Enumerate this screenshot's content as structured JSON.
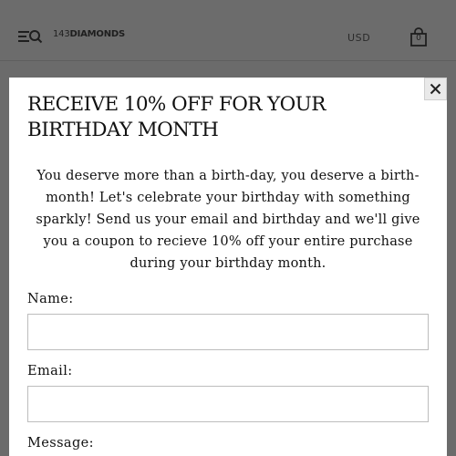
{
  "header": {
    "logo_number": "143",
    "logo_brand": "DIAMONDS",
    "currency": "USD",
    "cart_count": "0",
    "icons": [
      "menu-icon",
      "search-icon",
      "shopping-bag-icon"
    ]
  },
  "popup": {
    "title": "RECEIVE 10% OFF FOR YOUR BIRTHDAY MONTH",
    "description": "You deserve more than a birth-day, you deserve a birth-month! Let's celebrate your birthday with something sparkly! Send us your email and birthday and we'll give you a coupon to recieve 10% off your entire purchase during your birthday month.",
    "close_label": "✕",
    "fields": {
      "name_label": "Name:",
      "name_value": "",
      "email_label": "Email:",
      "email_value": "",
      "message_label": "Message:"
    }
  },
  "colors": {
    "overlay": "#6b6b6b",
    "modal_bg": "#ffffff",
    "text": "#111111",
    "input_border": "#bdbdbd"
  }
}
